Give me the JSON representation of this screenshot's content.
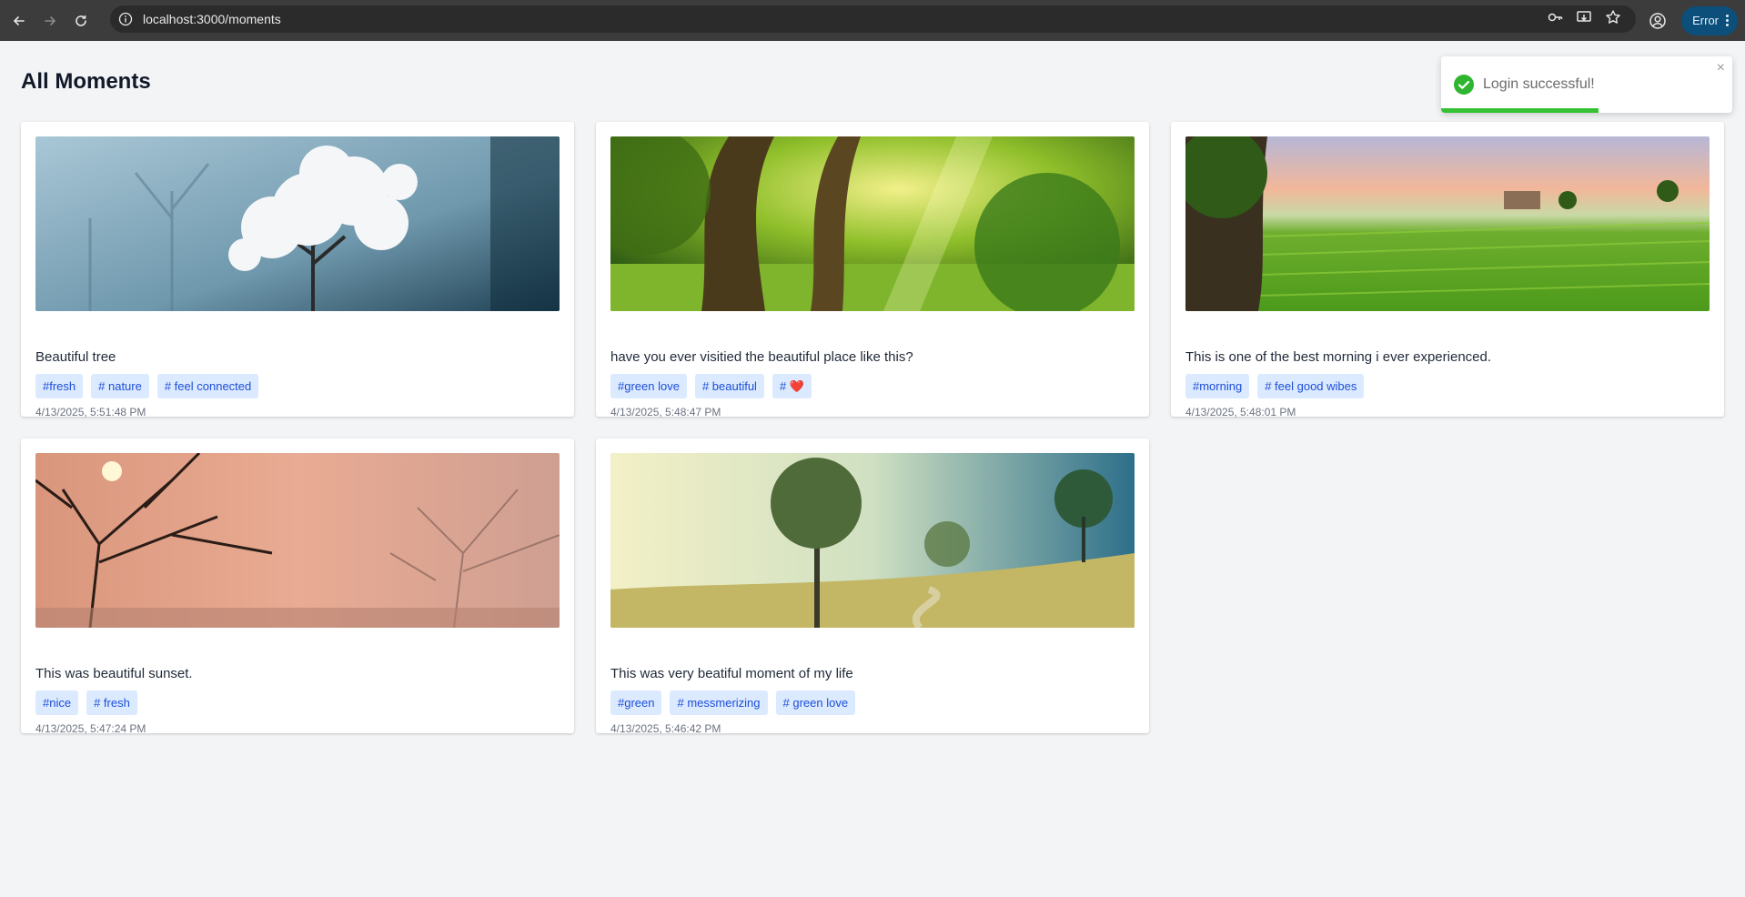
{
  "browser": {
    "url": "localhost:3000/moments",
    "error_label": "Error"
  },
  "page": {
    "title": "All Moments"
  },
  "toast": {
    "message": "Login successful!",
    "close": "×",
    "progress": 0.54,
    "color": "#34c134"
  },
  "moments": [
    {
      "caption": "Beautiful tree",
      "tags": [
        "#fresh",
        "# nature",
        "# feel connected"
      ],
      "time": "4/13/2025, 5:51:48 PM"
    },
    {
      "caption": "have you ever visitied the beautiful place like this?",
      "tags": [
        "#green love",
        "# beautiful",
        "# ❤️"
      ],
      "time": "4/13/2025, 5:48:47 PM"
    },
    {
      "caption": "This is one of the best morning i ever experienced.",
      "tags": [
        "#morning",
        "# feel good wibes"
      ],
      "time": "4/13/2025, 5:48:01 PM"
    },
    {
      "caption": "This was beautiful sunset.",
      "tags": [
        "#nice",
        "# fresh"
      ],
      "time": "4/13/2025, 5:47:24 PM"
    },
    {
      "caption": "This was very beatiful moment of my life",
      "tags": [
        "#green",
        "# messmerizing",
        "# green love"
      ],
      "time": "4/13/2025, 5:46:42 PM"
    }
  ]
}
